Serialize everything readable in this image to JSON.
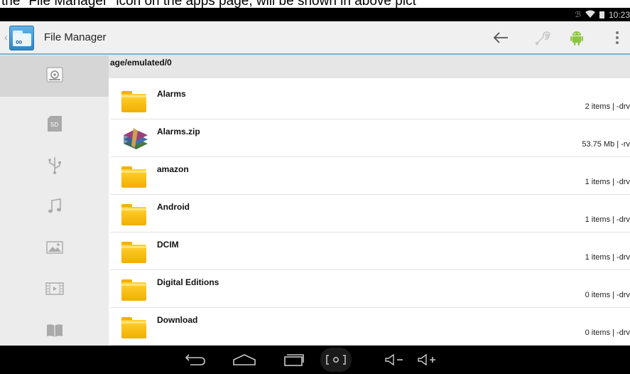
{
  "caption": {
    "text": "the \"File Manager\" icon on the apps page, will be shown in above pict"
  },
  "status_bar": {
    "time": "10:23"
  },
  "action_bar": {
    "title": "File Manager",
    "buttons": [
      {
        "name": "back-arrow-icon"
      },
      {
        "name": "wrench-icon"
      },
      {
        "name": "android-icon"
      },
      {
        "name": "overflow-menu-icon"
      }
    ]
  },
  "sidebar": {
    "items": [
      {
        "name": "internal-storage",
        "icon": "storage-icon",
        "selected": true
      },
      {
        "name": "sd-card",
        "icon": "sd-card-icon",
        "selected": false
      },
      {
        "name": "usb",
        "icon": "usb-icon",
        "selected": false
      },
      {
        "name": "music",
        "icon": "music-icon",
        "selected": false
      },
      {
        "name": "pictures",
        "icon": "picture-icon",
        "selected": false
      },
      {
        "name": "videos",
        "icon": "film-icon",
        "selected": false
      },
      {
        "name": "books",
        "icon": "book-icon",
        "selected": false
      }
    ]
  },
  "path": "age/emulated/0",
  "files": [
    {
      "name": "Alarms",
      "meta": "2 items | -drv",
      "type": "folder"
    },
    {
      "name": "Alarms.zip",
      "meta": "53.75 Mb  | -rv",
      "type": "archive"
    },
    {
      "name": "amazon",
      "meta": "1 items | -drv",
      "type": "folder"
    },
    {
      "name": "Android",
      "meta": "1 items | -drv",
      "type": "folder"
    },
    {
      "name": "DCIM",
      "meta": "1 items | -drv",
      "type": "folder"
    },
    {
      "name": "Digital Editions",
      "meta": "0 items | -drv",
      "type": "folder"
    },
    {
      "name": "Download",
      "meta": "0 items | -drv",
      "type": "folder"
    }
  ],
  "nav_bar": {
    "buttons": [
      {
        "name": "back-nav-icon"
      },
      {
        "name": "home-nav-icon"
      },
      {
        "name": "recents-nav-icon"
      },
      {
        "name": "screenshot-nav-icon"
      },
      {
        "name": "volume-down-icon"
      },
      {
        "name": "volume-up-icon"
      }
    ]
  },
  "colors": {
    "accent": "#7fb2c9",
    "folder": "#f2ae00"
  }
}
